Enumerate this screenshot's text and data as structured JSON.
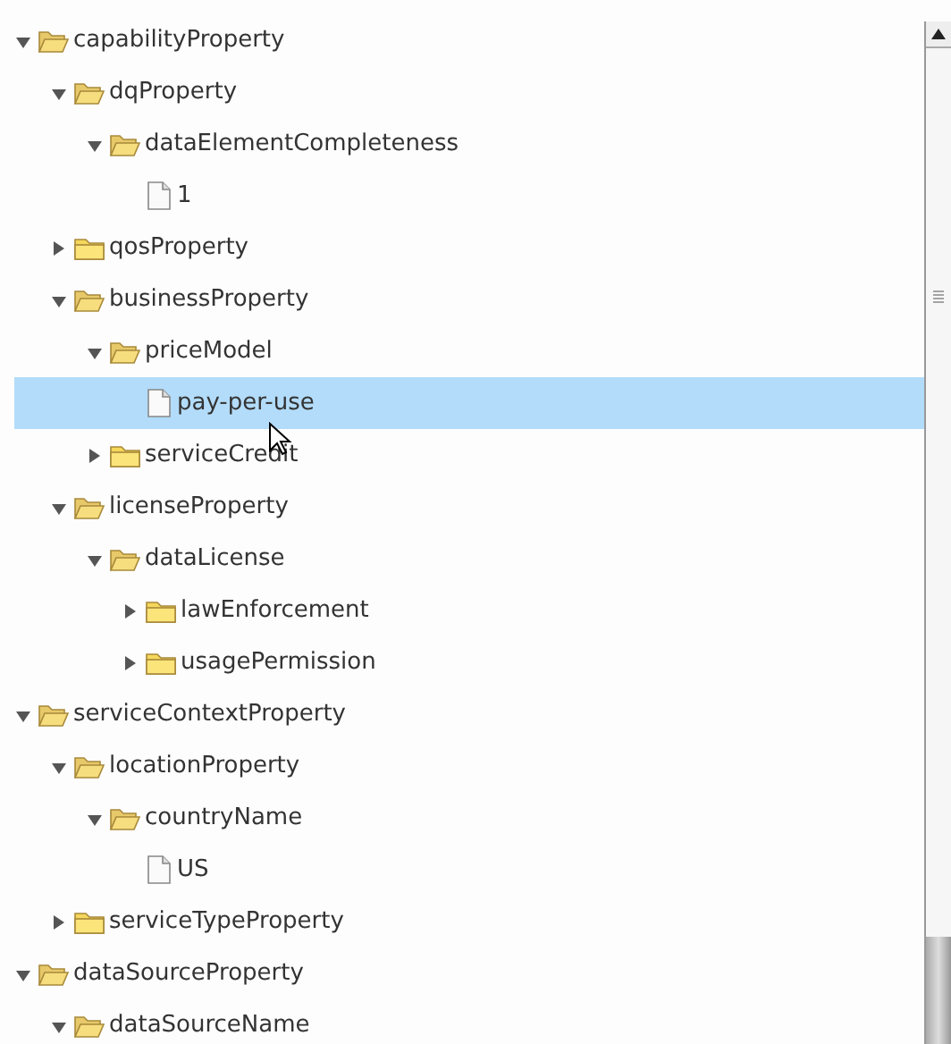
{
  "tree": [
    {
      "label": "capabilityProperty",
      "kind": "folder",
      "expanded": true,
      "selected": false,
      "children": [
        {
          "label": "dqProperty",
          "kind": "folder",
          "expanded": true,
          "selected": false,
          "children": [
            {
              "label": "dataElementCompleteness",
              "kind": "folder",
              "expanded": true,
              "selected": false,
              "children": [
                {
                  "label": "1",
                  "kind": "file",
                  "selected": false
                }
              ]
            }
          ]
        },
        {
          "label": "qosProperty",
          "kind": "folder",
          "expanded": false,
          "selected": false
        },
        {
          "label": "businessProperty",
          "kind": "folder",
          "expanded": true,
          "selected": false,
          "children": [
            {
              "label": "priceModel",
              "kind": "folder",
              "expanded": true,
              "selected": false,
              "children": [
                {
                  "label": "pay-per-use",
                  "kind": "file",
                  "selected": true
                }
              ]
            },
            {
              "label": "serviceCredit",
              "kind": "folder",
              "expanded": false,
              "selected": false
            }
          ]
        },
        {
          "label": "licenseProperty",
          "kind": "folder",
          "expanded": true,
          "selected": false,
          "children": [
            {
              "label": "dataLicense",
              "kind": "folder",
              "expanded": true,
              "selected": false,
              "children": [
                {
                  "label": "lawEnforcement",
                  "kind": "folder",
                  "expanded": false,
                  "selected": false
                },
                {
                  "label": "usagePermission",
                  "kind": "folder",
                  "expanded": false,
                  "selected": false
                }
              ]
            }
          ]
        }
      ]
    },
    {
      "label": "serviceContextProperty",
      "kind": "folder",
      "expanded": true,
      "selected": false,
      "children": [
        {
          "label": "locationProperty",
          "kind": "folder",
          "expanded": true,
          "selected": false,
          "children": [
            {
              "label": "countryName",
              "kind": "folder",
              "expanded": true,
              "selected": false,
              "children": [
                {
                  "label": "US",
                  "kind": "file",
                  "selected": false
                }
              ]
            }
          ]
        },
        {
          "label": "serviceTypeProperty",
          "kind": "folder",
          "expanded": false,
          "selected": false
        }
      ]
    },
    {
      "label": "dataSourceProperty",
      "kind": "folder",
      "expanded": true,
      "selected": false,
      "children": [
        {
          "label": "dataSourceName",
          "kind": "folder",
          "expanded": true,
          "selected": false
        }
      ]
    }
  ]
}
